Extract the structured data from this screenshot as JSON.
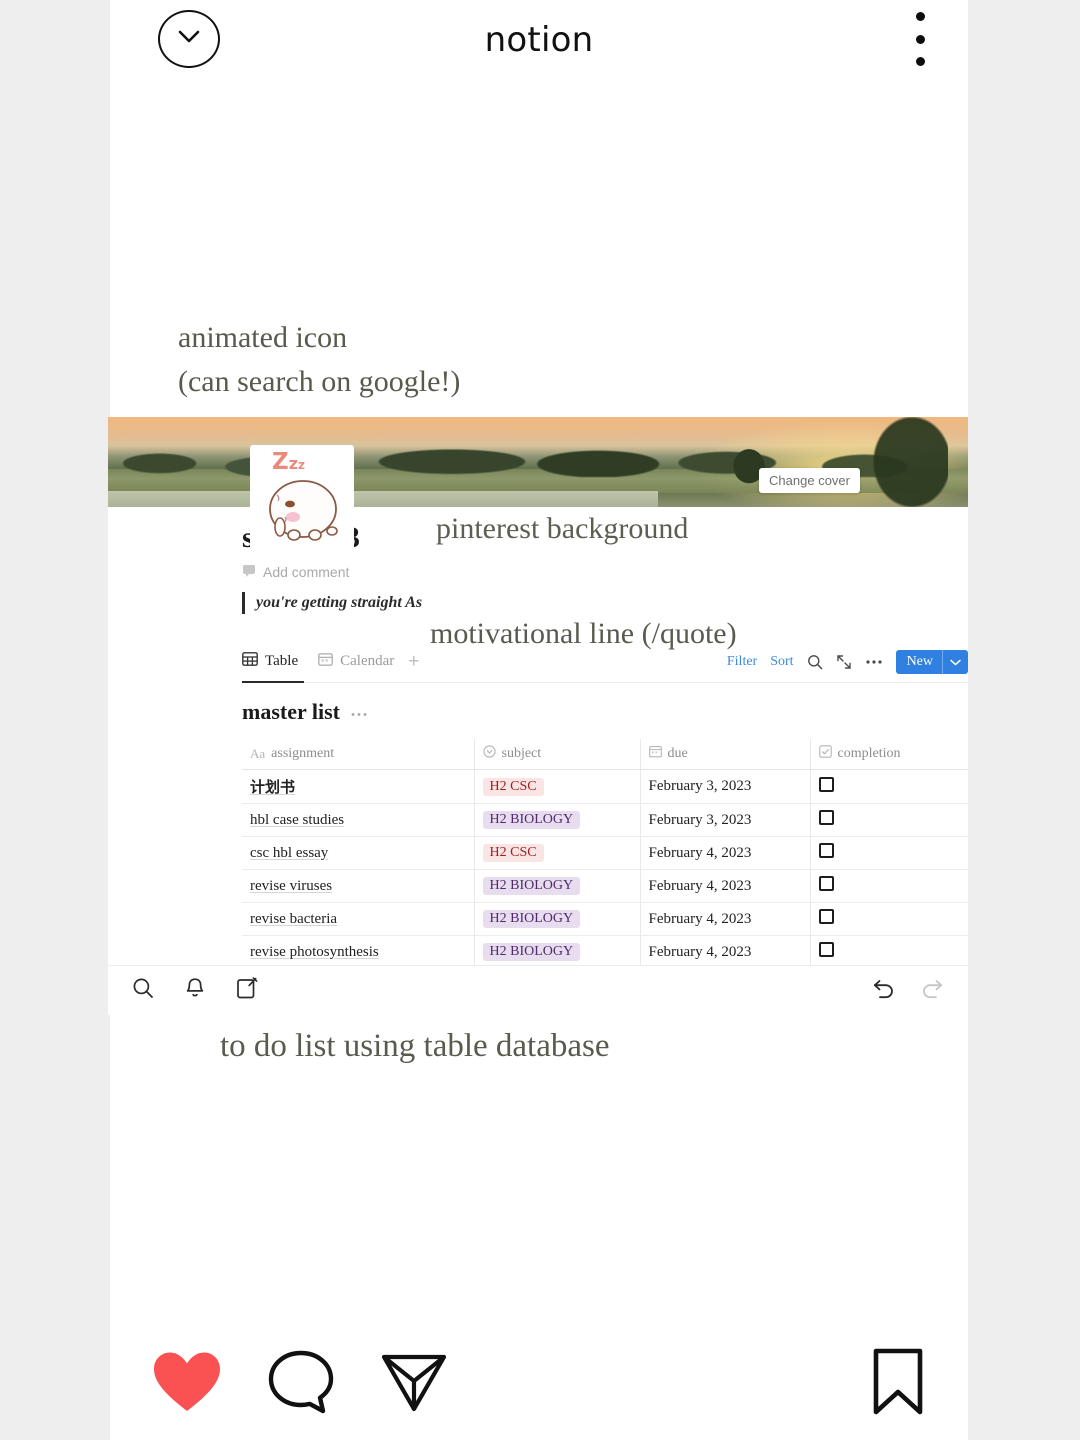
{
  "app": {
    "header": {
      "title": "notion",
      "back_icon": "chevron-down-icon",
      "menu_icon": "kebab-menu-icon"
    },
    "actions": {
      "like_icon": "heart-icon",
      "comment_icon": "comment-bubble-icon",
      "share_icon": "paper-plane-icon",
      "save_icon": "bookmark-icon",
      "like_color": "#fa5252"
    }
  },
  "annotations": {
    "icon_note_line1": "animated icon",
    "icon_note_line2": "(can search on google!)",
    "cover_note": "pinterest background",
    "quote_note": "motivational line (/quote)",
    "table_note": "to do list using table database"
  },
  "notion": {
    "cover": {
      "change_cover_label": "Change cover"
    },
    "page_icon": {
      "name": "sleeping-mochi-icon",
      "zzz_big": "Z",
      "zzz_mid": "z",
      "zzz_small": "z"
    },
    "page_title": "school <3",
    "add_comment_label": "Add comment",
    "comment_icon": "speech-bubble-icon",
    "quote": "you're getting straight As",
    "database": {
      "tabs": [
        {
          "label": "Table",
          "icon": "table-view-icon",
          "active": true
        },
        {
          "label": "Calendar",
          "icon": "calendar-view-icon",
          "active": false
        }
      ],
      "add_view_label": "+",
      "toolbar": {
        "filter_label": "Filter",
        "sort_label": "Sort",
        "search_icon": "search-icon",
        "expand_icon": "expand-arrows-icon",
        "more_icon": "more-options-icon",
        "new_label": "New",
        "new_chevron_icon": "chevron-down-icon",
        "accent_color": "#2f80e0",
        "link_color": "#3c8ae0"
      },
      "title": "master list",
      "title_menu": "•••",
      "columns": [
        {
          "label": "assignment",
          "icon": "text-property-icon",
          "icon_glyph": "Aa"
        },
        {
          "label": "subject",
          "icon": "select-property-icon"
        },
        {
          "label": "due",
          "icon": "date-property-icon"
        },
        {
          "label": "completion",
          "icon": "checkbox-property-icon"
        }
      ],
      "rows": [
        {
          "assignment": "计划书",
          "cjk": true,
          "subject": "H2 CSC",
          "subject_type": "csc",
          "due": "February 3, 2023",
          "completed": false
        },
        {
          "assignment": "hbl case studies",
          "cjk": false,
          "subject": "H2 BIOLOGY",
          "subject_type": "bio",
          "due": "February 3, 2023",
          "completed": false
        },
        {
          "assignment": "csc hbl essay",
          "cjk": false,
          "subject": "H2 CSC",
          "subject_type": "csc",
          "due": "February 4, 2023",
          "completed": false
        },
        {
          "assignment": "revise viruses",
          "cjk": false,
          "subject": "H2 BIOLOGY",
          "subject_type": "bio",
          "due": "February 4, 2023",
          "completed": false
        },
        {
          "assignment": "revise bacteria",
          "cjk": false,
          "subject": "H2 BIOLOGY",
          "subject_type": "bio",
          "due": "February 4, 2023",
          "completed": false
        },
        {
          "assignment": "revise photosynthesis",
          "cjk": false,
          "subject": "H2 BIOLOGY",
          "subject_type": "bio",
          "due": "February 4, 2023",
          "completed": false
        }
      ]
    },
    "bottom_bar": {
      "search_icon": "search-icon",
      "notifications_icon": "bell-icon",
      "compose_icon": "compose-note-icon",
      "undo_icon": "undo-arrow-icon",
      "redo_icon": "redo-arrow-icon"
    }
  },
  "colors": {
    "page_background": "#eeeeee",
    "card_background": "#ffffff",
    "tag_csc_bg": "#fbe4e4",
    "tag_csc_text": "#9b2121",
    "tag_bio_bg": "#e7ddef",
    "tag_bio_text": "#4f2b6b",
    "annotation_text": "#59594e"
  }
}
